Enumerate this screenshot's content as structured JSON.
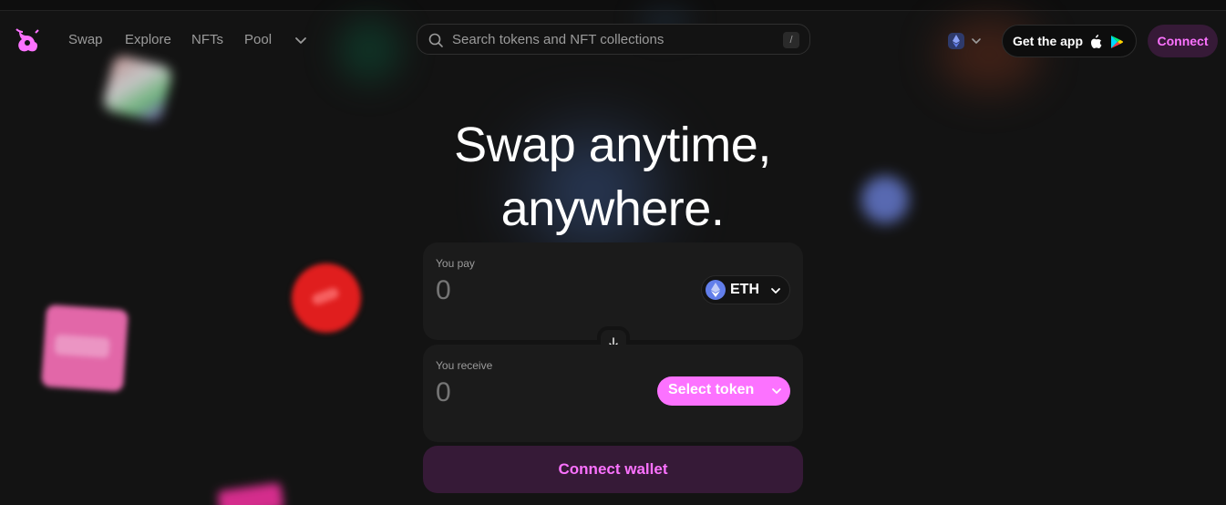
{
  "nav": {
    "links": [
      "Swap",
      "Explore",
      "NFTs",
      "Pool"
    ],
    "search_placeholder": "Search tokens and NFT collections",
    "search_shortcut": "/",
    "get_app_label": "Get the app",
    "connect_label": "Connect"
  },
  "hero": {
    "line1": "Swap anytime,",
    "line2": "anywhere."
  },
  "swap": {
    "pay_label": "You pay",
    "pay_amount": "0",
    "pay_token": "ETH",
    "receive_label": "You receive",
    "receive_amount": "0",
    "select_token_label": "Select token",
    "connect_wallet_label": "Connect wallet"
  },
  "colors": {
    "accent": "#fc72ff",
    "accent_bg": "#361a37",
    "background": "#131313",
    "panel": "#1b1b1b"
  }
}
